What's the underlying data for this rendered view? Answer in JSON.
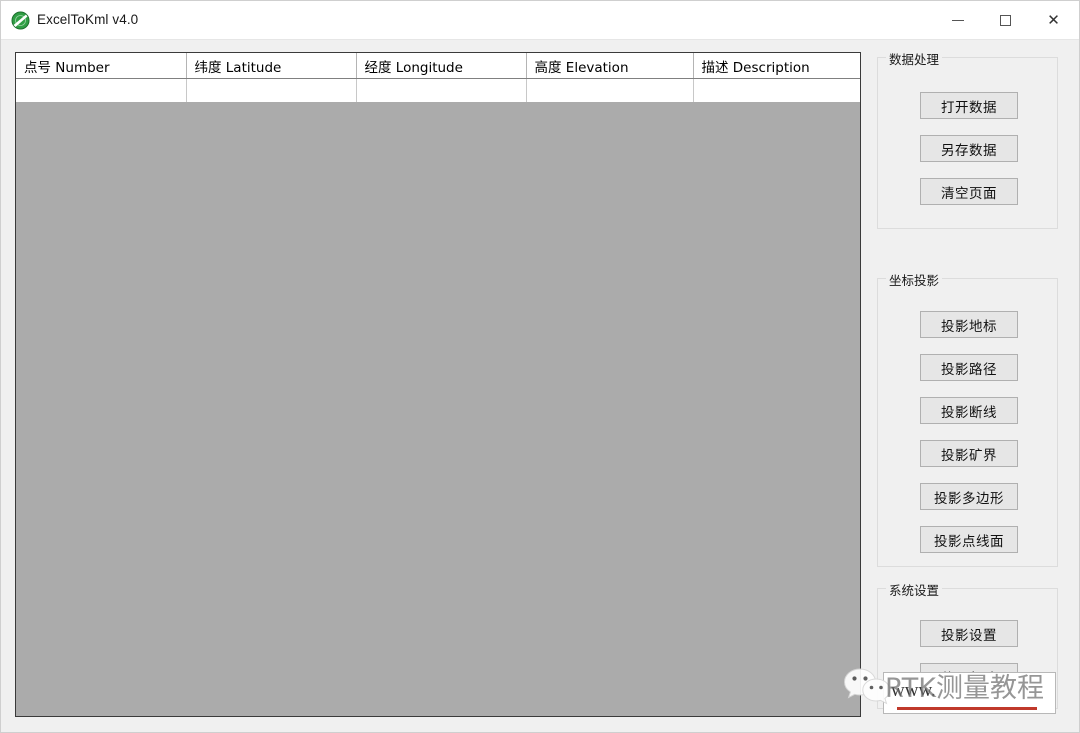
{
  "window": {
    "title": "ExcelToKml v4.0",
    "icon": "excel-to-kml-green-disc-icon",
    "controls": {
      "minimize": "minimize-icon",
      "maximize": "maximize-icon",
      "close": "✕"
    }
  },
  "grid": {
    "columns": [
      "点号 Number",
      "纬度 Latitude",
      "经度 Longitude",
      "高度 Elevation",
      "描述 Description"
    ],
    "rows": [
      [
        "",
        "",
        "",
        "",
        ""
      ]
    ]
  },
  "panel": {
    "groups": [
      {
        "title": "数据处理",
        "buttons": [
          "打开数据",
          "另存数据",
          "清空页面"
        ]
      },
      {
        "title": "坐标投影",
        "buttons": [
          "投影地标",
          "投影路径",
          "投影断线",
          "投影矿界",
          "投影多边形",
          "投影点线面"
        ]
      },
      {
        "title": "系统设置",
        "buttons": [
          "投影设置",
          "使用帮助"
        ]
      }
    ]
  },
  "url_box": {
    "text": "www."
  },
  "watermark": {
    "text": "RTK测量教程",
    "logo": "wechat-icon"
  },
  "colors": {
    "grid_empty": "#ababab",
    "window_bg": "#f0f0f0",
    "button_bg": "#e6e6e6",
    "accent_red": "#c0392b",
    "icon_green": "#2f9e44"
  }
}
